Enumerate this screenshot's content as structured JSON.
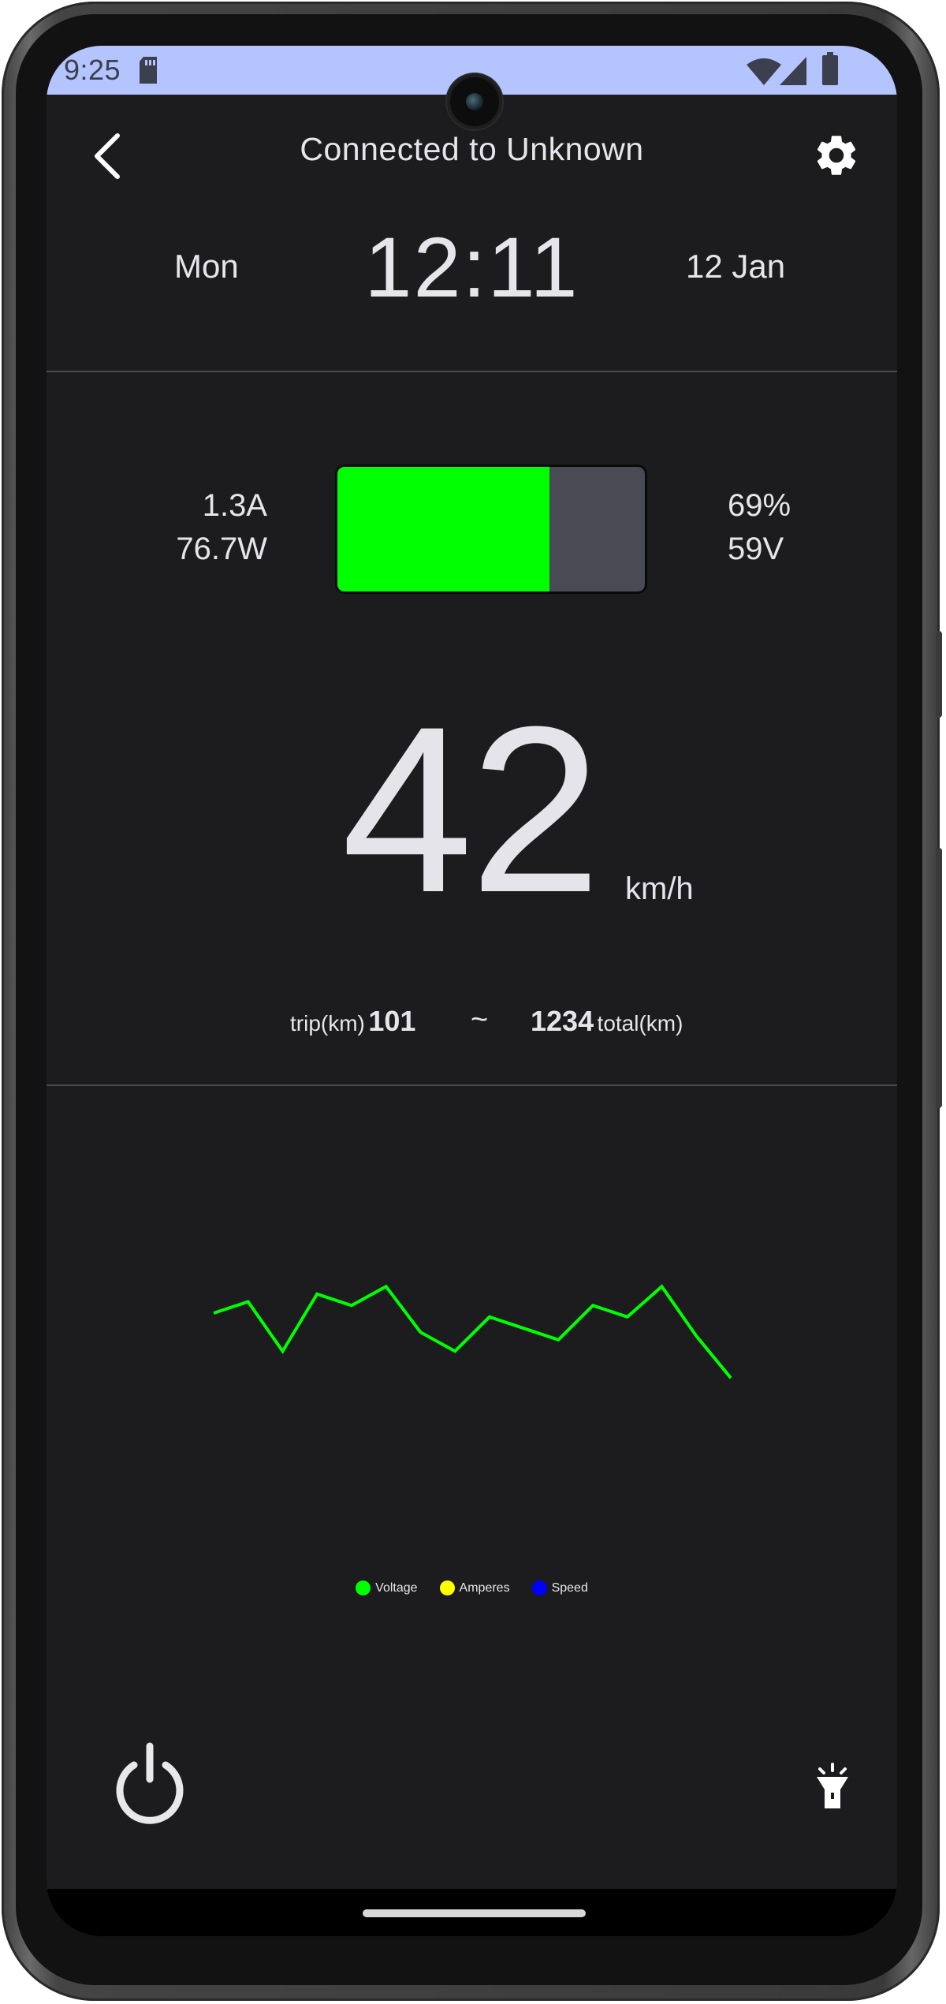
{
  "status_bar": {
    "time": "9:25",
    "icons": [
      "sd-card-icon",
      "wifi-icon",
      "cellular-signal-icon",
      "battery-icon"
    ]
  },
  "topbar": {
    "title": "Connected to Unknown",
    "back_icon": "chevron-left-icon",
    "settings_icon": "gear-icon"
  },
  "clock_row": {
    "day": "Mon",
    "time": "12:11",
    "date": "12 Jan"
  },
  "battery_panel": {
    "current": "1.3A",
    "power": "76.7W",
    "percent": "69%",
    "voltage": "59V",
    "fill_fraction": 0.69,
    "fill_color": "#00ff00",
    "empty_color": "#4a4a54"
  },
  "speedometer": {
    "speed": "42",
    "unit": "km/h"
  },
  "odometer": {
    "trip_label": "trip(km)",
    "trip_value": "101",
    "separator": "~",
    "total_value": "1234",
    "total_label": "total(km)"
  },
  "chart_data": {
    "type": "line",
    "series": [
      {
        "name": "Voltage",
        "color": "#00ff00",
        "values": [
          62,
          65,
          52,
          67,
          64,
          69,
          57,
          52,
          61,
          58,
          55,
          64,
          61,
          69,
          56,
          45
        ]
      },
      {
        "name": "Amperes",
        "color": "#ffff00",
        "values": []
      },
      {
        "name": "Speed",
        "color": "#0000ff",
        "values": []
      }
    ],
    "legend_position": "bottom-center",
    "grid": false
  },
  "controls": {
    "power_icon": "power-icon",
    "light_icon": "flashlight-icon"
  }
}
